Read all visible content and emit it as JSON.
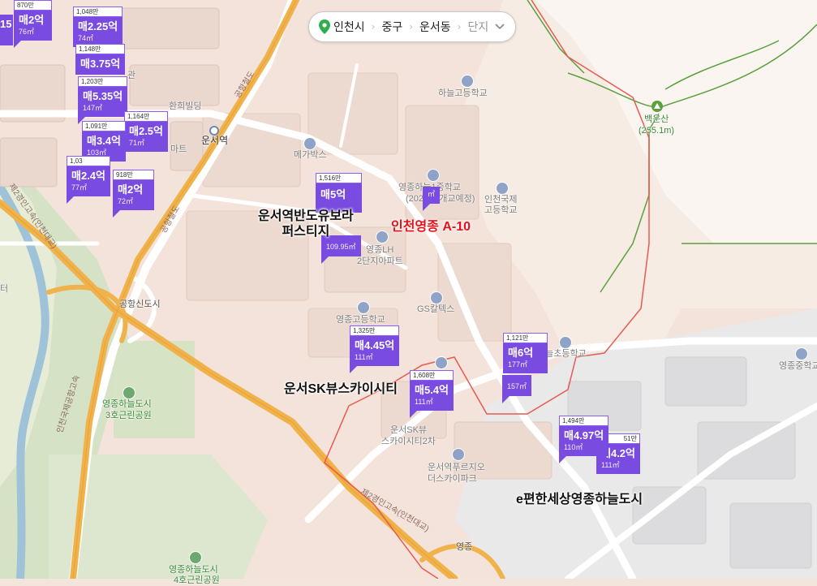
{
  "breadcrumb": {
    "province": "인천시",
    "district": "중구",
    "dong": "운서동",
    "complex_placeholder": "단지",
    "pin_icon": "location-pin-icon",
    "dropdown_icon": "chevron-down-icon"
  },
  "places": {
    "haneul_high": "하늘고등학교",
    "hwanhee": "환희빌딩",
    "unseo_station": "운서역",
    "megabox": "메가박스",
    "haneul_middle_1": "영종하늘1중학교",
    "haneul_middle_2": "(2026년 개교예정)",
    "incheon_intl_high_1": "인천국제",
    "incheon_intl_high_2": "고등학교",
    "lh_apt_1": "영종LH",
    "lh_apt_2": "2단지아파트",
    "gs": "GS칼텍스",
    "yeongjong_high": "영종고등학교",
    "haneul_elem": "하늘초등학교",
    "sk_sky_2_1": "운서SK뷰",
    "sk_sky_2_2": "스카이시티2차",
    "prugio_1": "운서역푸르지오",
    "prugio_2": "더스카이파크",
    "yeongjong_middle": "영종중학교",
    "park_3_1": "영종하늘도시",
    "park_3_2": "3호근린공원",
    "park_4_1": "영종하늘도시",
    "park_4_2": "4호근린공원",
    "airport_city_jc": "공항신도시",
    "yeongjong_ic": "영종",
    "mall_partial": "마트",
    "hall_partial": "관",
    "left_partial": "터"
  },
  "mountain": {
    "name": "백운산",
    "height": "(255.1m)"
  },
  "roads": {
    "airport_road_1": "공항철도",
    "airport_road_2": "공항철도",
    "second_bridge": "제2경인고속(인천대교)",
    "airport_expressway": "인천국제공항고속",
    "left_expressway": "제2경인고속(인천대교)"
  },
  "complexes": {
    "bando": "운서역반도유보라\n퍼스티지",
    "incheon_a10": "인천영종 A-10",
    "sk_sky": "운서SK뷰스카이시티",
    "ehansesang": "e편한세상영종하늘도시"
  },
  "markers": [
    {
      "pp": "1,048만",
      "price": "매2.25억",
      "area": "74㎡"
    },
    {
      "pp": "1,148만",
      "price": "매3.75억",
      "area": ""
    },
    {
      "pp": "1,203만",
      "price": "매5.35억",
      "area": "147㎡"
    },
    {
      "pp": "1,164만",
      "price": "매2.5억",
      "area": "71㎡"
    },
    {
      "pp": "1,091만",
      "price": "매3.4억",
      "area": "103㎡"
    },
    {
      "pp": "1,03",
      "price": "매2.4억",
      "area": "77㎡"
    },
    {
      "pp": "918만",
      "price": "매2억",
      "area": "72㎡"
    },
    {
      "pp": "870만",
      "price": "매2억",
      "area": "76㎡"
    },
    {
      "pp": "",
      "price": "15",
      "area": ""
    },
    {
      "pp": "1,516만",
      "price": "매5억",
      "area": ""
    },
    {
      "pp": "",
      "price": "",
      "area": "109.95㎡"
    },
    {
      "pp": "",
      "price": "",
      "area": "㎡"
    },
    {
      "pp": "1,325만",
      "price": "매4.45억",
      "area": "111㎡"
    },
    {
      "pp": "1,608만",
      "price": "매5.4억",
      "area": "111㎡"
    },
    {
      "pp": "1,121만",
      "price": "매6억",
      "area": "177㎡"
    },
    {
      "pp": "",
      "price": "",
      "area": "157㎡"
    },
    {
      "pp": "1,494만",
      "price": "매4.97억",
      "area": "110㎡"
    },
    {
      "pp": "51만",
      "price": "매4.2억",
      "area": "111㎡"
    }
  ],
  "colors": {
    "marker": "#7a4be0",
    "boundary": "#e8594f",
    "complex_red": "#e8101a",
    "mountain_line": "#5aa03c"
  }
}
